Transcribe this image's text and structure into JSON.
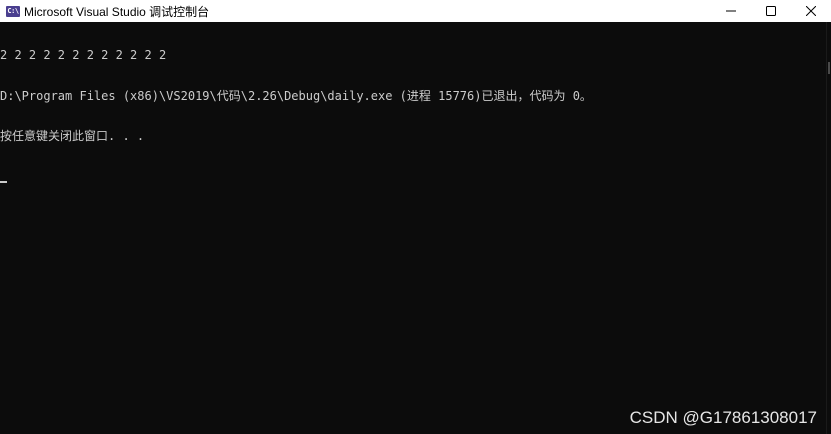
{
  "window": {
    "title": "Microsoft Visual Studio 调试控制台",
    "icon": "console-app-icon",
    "icon_text": "C:\\"
  },
  "controls": {
    "minimize": "minimize-icon",
    "maximize": "maximize-icon",
    "close": "close-icon"
  },
  "console": {
    "lines": [
      "2 2 2 2 2 2 2 2 2 2 2 2",
      "D:\\Program Files (x86)\\VS2019\\代码\\2.26\\Debug\\daily.exe (进程 15776)已退出，代码为 0。",
      "按任意键关闭此窗口. . ."
    ],
    "text_color": "#cccccc",
    "background": "#0c0c0c"
  },
  "watermark": "CSDN @G17861308017"
}
